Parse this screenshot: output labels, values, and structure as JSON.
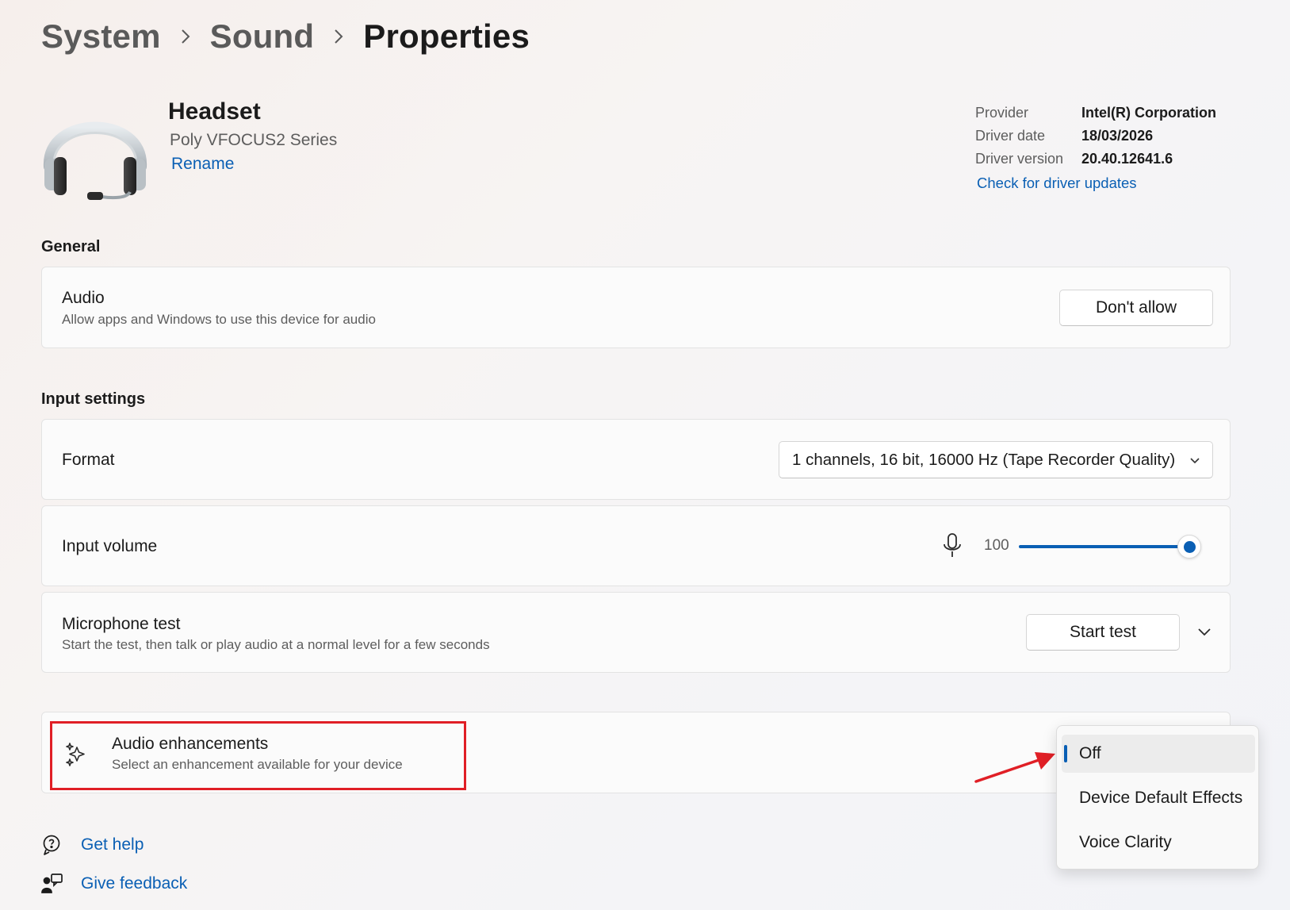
{
  "breadcrumb": {
    "items": [
      "System",
      "Sound",
      "Properties"
    ]
  },
  "device": {
    "name": "Headset",
    "model": "Poly VFOCUS2 Series",
    "rename_label": "Rename",
    "icon": "headset-icon"
  },
  "driver": {
    "provider_label": "Provider",
    "provider_value": "Intel(R) Corporation",
    "date_label": "Driver date",
    "date_value": "18/03/2026",
    "version_label": "Driver version",
    "version_value": "20.40.12641.6",
    "update_link": "Check for driver updates"
  },
  "general": {
    "title": "General",
    "audio": {
      "title": "Audio",
      "subtitle": "Allow apps and Windows to use this device for audio",
      "button": "Don't allow"
    }
  },
  "input_settings": {
    "title": "Input settings",
    "format": {
      "title": "Format",
      "selected": "1 channels, 16 bit, 16000 Hz (Tape Recorder Quality)"
    },
    "volume": {
      "title": "Input volume",
      "value": "100",
      "level_percent": 100,
      "icon": "microphone-icon"
    },
    "mic_test": {
      "title": "Microphone test",
      "subtitle": "Start the test, then talk or play audio at a normal level for a few seconds",
      "button": "Start test"
    }
  },
  "enhancements": {
    "title": "Audio enhancements",
    "subtitle": "Select an enhancement available for your device",
    "icon": "sparkle-icon",
    "options": [
      "Off",
      "Device Default Effects",
      "Voice Clarity"
    ],
    "selected": "Off"
  },
  "footer": {
    "help": "Get help",
    "feedback": "Give feedback"
  },
  "colors": {
    "accent": "#0a5fb4",
    "highlight": "#e01f26"
  }
}
